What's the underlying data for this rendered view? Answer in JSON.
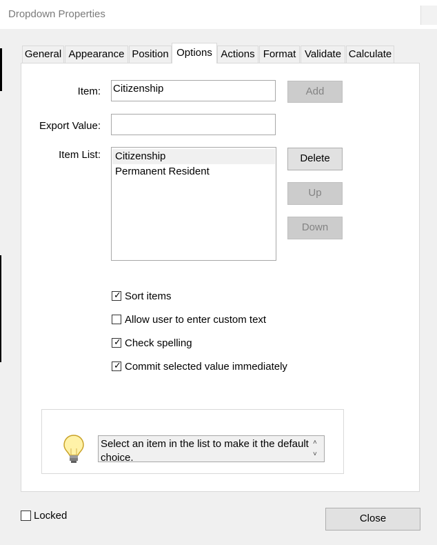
{
  "window": {
    "title": "Dropdown Properties"
  },
  "tabs": [
    {
      "label": "General"
    },
    {
      "label": "Appearance"
    },
    {
      "label": "Position"
    },
    {
      "label": "Options"
    },
    {
      "label": "Actions"
    },
    {
      "label": "Format"
    },
    {
      "label": "Validate"
    },
    {
      "label": "Calculate"
    }
  ],
  "active_tab": "Options",
  "options": {
    "item_label": "Item:",
    "item_value": "Citizenship",
    "export_label": "Export Value:",
    "export_value": "",
    "item_list_label": "Item List:",
    "items": [
      {
        "label": "Citizenship",
        "selected": true
      },
      {
        "label": "Permanent Resident",
        "selected": false
      }
    ],
    "buttons": {
      "add": "Add",
      "delete": "Delete",
      "up": "Up",
      "down": "Down"
    },
    "checkboxes": [
      {
        "label": "Sort items",
        "checked": true
      },
      {
        "label": "Allow user to enter custom text",
        "checked": false
      },
      {
        "label": "Check spelling",
        "checked": true
      },
      {
        "label": "Commit selected value immediately",
        "checked": true
      }
    ],
    "hint": "Select an item in the list to make it the default choice."
  },
  "footer": {
    "locked_label": "Locked",
    "locked_checked": false,
    "close_label": "Close"
  },
  "icons": {
    "hint": "lightbulb-icon",
    "checkmark": "✓"
  }
}
